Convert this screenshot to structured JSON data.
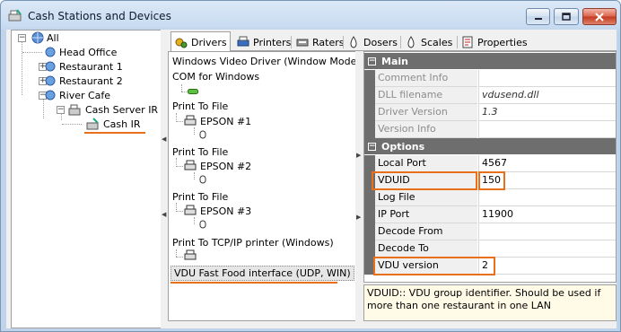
{
  "window": {
    "title": "Cash Stations and Devices"
  },
  "tree": {
    "root": "All",
    "items": [
      "Head Office",
      "Restaurant 1",
      "Restaurant 2",
      "River Cafe",
      "Cash Server IR",
      "Cash IR"
    ]
  },
  "tabs": [
    "Drivers",
    "Printers",
    "Raters",
    "Dosers",
    "Scales",
    "Properties"
  ],
  "drivers": {
    "items": [
      "Windows Video Driver (Window Mode)",
      "COM for Windows",
      "Print To File",
      "Print To File",
      "Print To File",
      "Print To TCP/IP printer (Windows)",
      "VDU Fast Food interface (UDP, WIN)"
    ],
    "devices": [
      "EPSON #1",
      "EPSON #2",
      "EPSON #3"
    ]
  },
  "properties": {
    "main": {
      "title": "Main",
      "rows": [
        {
          "name": "Comment Info",
          "value": ""
        },
        {
          "name": "DLL filename",
          "value": "vdusend.dll"
        },
        {
          "name": "Driver Version",
          "value": "1.3"
        },
        {
          "name": "Version Info",
          "value": ""
        }
      ]
    },
    "options": {
      "title": "Options",
      "rows": [
        {
          "name": "Local Port",
          "value": "4567"
        },
        {
          "name": "VDUID",
          "value": "150"
        },
        {
          "name": "Log File",
          "value": ""
        },
        {
          "name": "IP Port",
          "value": "11900"
        },
        {
          "name": "Decode From",
          "value": ""
        },
        {
          "name": "Decode To",
          "value": ""
        },
        {
          "name": "VDU version",
          "value": "2"
        }
      ]
    }
  },
  "description": "VDUID:: VDU group identifier. Should be used if more than one restaurant in one LAN",
  "colors": {
    "highlight": "#e8701a",
    "category": "#6e6e6e",
    "window_frame": "#bfd3ea"
  }
}
